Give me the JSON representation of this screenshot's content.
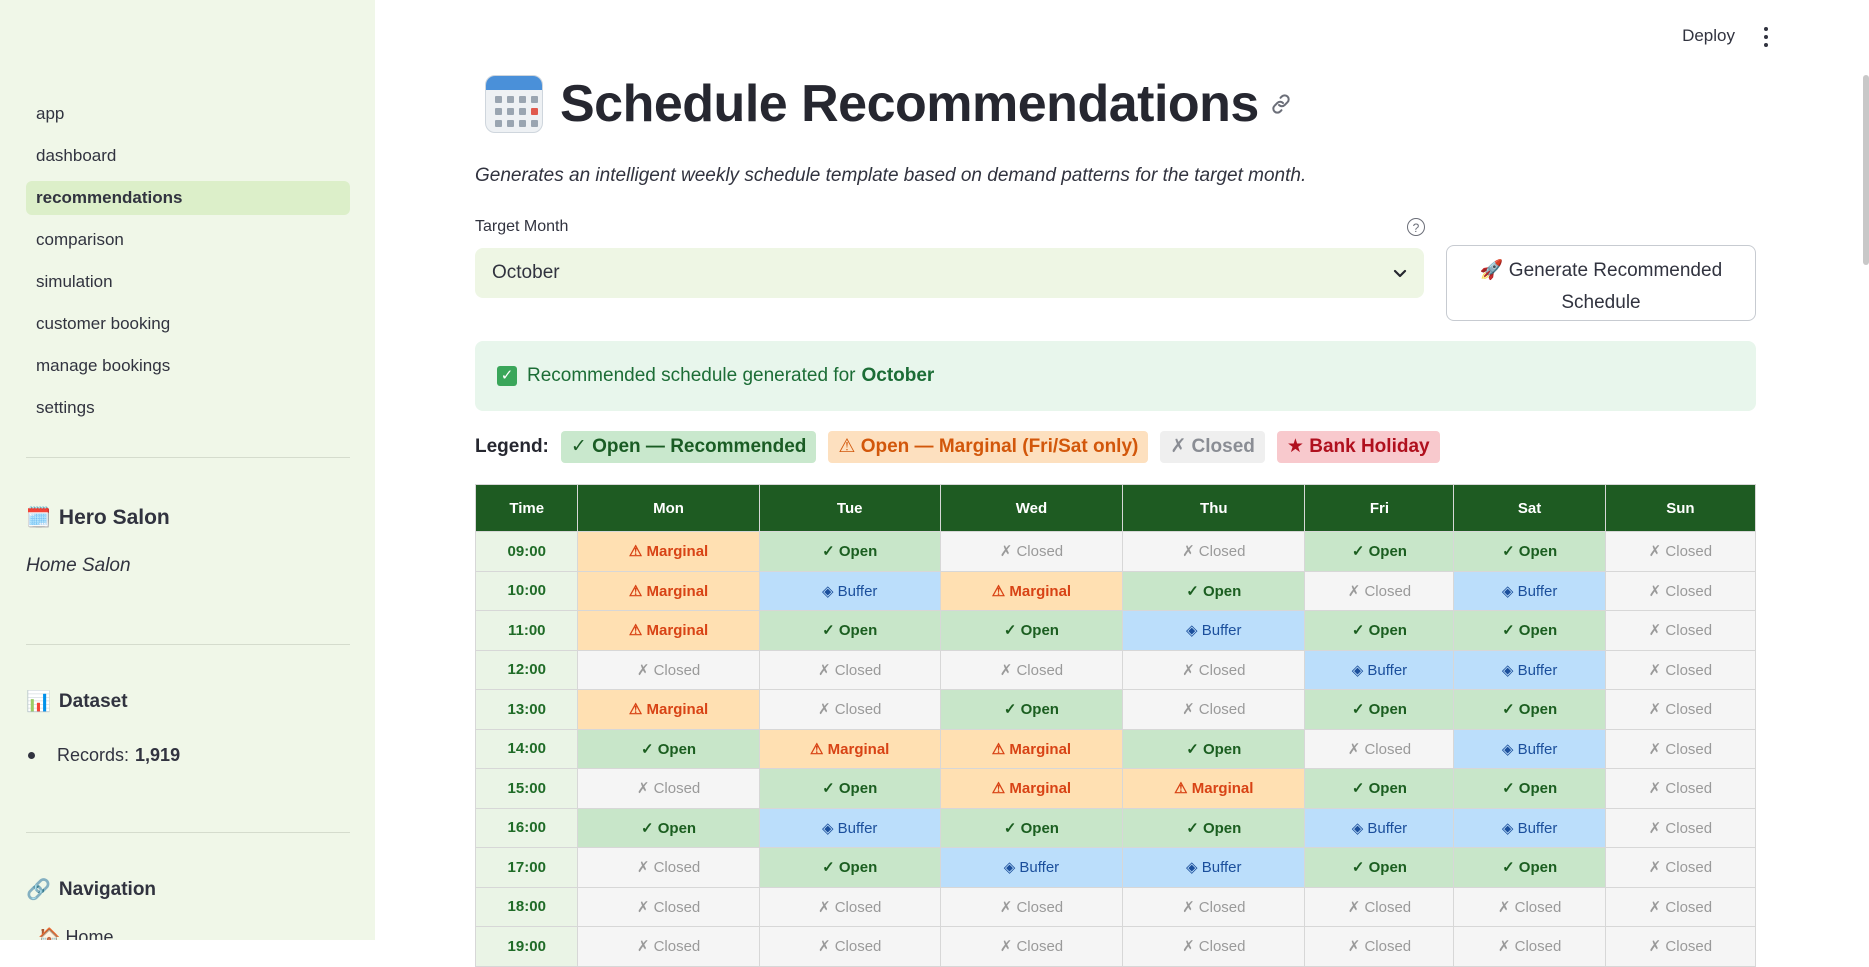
{
  "sidebar": {
    "nav_items": [
      {
        "label": "app",
        "active": false
      },
      {
        "label": "dashboard",
        "active": false
      },
      {
        "label": "recommendations",
        "active": true
      },
      {
        "label": "comparison",
        "active": false
      },
      {
        "label": "simulation",
        "active": false
      },
      {
        "label": "customer booking",
        "active": false
      },
      {
        "label": "manage bookings",
        "active": false
      },
      {
        "label": "settings",
        "active": false
      }
    ],
    "salon_title": "Hero Salon",
    "salon_subtitle": "Home Salon",
    "dataset_title": "Dataset",
    "records_label": "Records:",
    "records_value": "1,919",
    "navigation_title": "Navigation",
    "home_link": "Home"
  },
  "topbar": {
    "deploy_label": "Deploy"
  },
  "page": {
    "title": "Schedule Recommendations",
    "subtitle": "Generates an intelligent weekly schedule template based on demand patterns for the target month.",
    "target_month_label": "Target Month",
    "target_month_value": "October",
    "generate_button": "🚀 Generate Recommended Schedule",
    "success_text": "Recommended schedule generated for",
    "success_month": "October"
  },
  "legend": {
    "label": "Legend:",
    "items": [
      {
        "text": "✓ Open — Recommended",
        "kind": "open"
      },
      {
        "text": "⚠ Open — Marginal (Fri/Sat only)",
        "kind": "marg"
      },
      {
        "text": "✗ Closed",
        "kind": "closed"
      },
      {
        "text": "★ Bank Holiday",
        "kind": "hol"
      }
    ]
  },
  "schedule": {
    "headers": [
      "Time",
      "Mon",
      "Tue",
      "Wed",
      "Thu",
      "Fri",
      "Sat",
      "Sun"
    ],
    "cell_labels": {
      "open": "✓ Open",
      "marginal": "⚠ Marginal",
      "buffer": "◈ Buffer",
      "closed": "✗ Closed"
    },
    "rows": [
      {
        "time": "09:00",
        "cells": [
          "marginal",
          "open",
          "closed",
          "closed",
          "open",
          "open",
          "closed"
        ]
      },
      {
        "time": "10:00",
        "cells": [
          "marginal",
          "buffer",
          "marginal",
          "open",
          "closed",
          "buffer",
          "closed"
        ]
      },
      {
        "time": "11:00",
        "cells": [
          "marginal",
          "open",
          "open",
          "buffer",
          "open",
          "open",
          "closed"
        ]
      },
      {
        "time": "12:00",
        "cells": [
          "closed",
          "closed",
          "closed",
          "closed",
          "buffer",
          "buffer",
          "closed"
        ]
      },
      {
        "time": "13:00",
        "cells": [
          "marginal",
          "closed",
          "open",
          "closed",
          "open",
          "open",
          "closed"
        ]
      },
      {
        "time": "14:00",
        "cells": [
          "open",
          "marginal",
          "marginal",
          "open",
          "closed",
          "buffer",
          "closed"
        ]
      },
      {
        "time": "15:00",
        "cells": [
          "closed",
          "open",
          "marginal",
          "marginal",
          "open",
          "open",
          "closed"
        ]
      },
      {
        "time": "16:00",
        "cells": [
          "open",
          "buffer",
          "open",
          "open",
          "buffer",
          "buffer",
          "closed"
        ]
      },
      {
        "time": "17:00",
        "cells": [
          "closed",
          "open",
          "buffer",
          "buffer",
          "open",
          "open",
          "closed"
        ]
      },
      {
        "time": "18:00",
        "cells": [
          "closed",
          "closed",
          "closed",
          "closed",
          "closed",
          "closed",
          "closed"
        ]
      },
      {
        "time": "19:00",
        "cells": [
          "closed",
          "closed",
          "closed",
          "closed",
          "closed",
          "closed",
          "closed"
        ]
      }
    ]
  },
  "colors": {
    "sidebar_bg": "#f0f7e8",
    "header_green": "#1e5b22",
    "open_bg": "#c8e6c9",
    "marginal_bg": "#ffe0b2",
    "buffer_bg": "#bbdefb",
    "closed_bg": "#f5f5f5"
  }
}
